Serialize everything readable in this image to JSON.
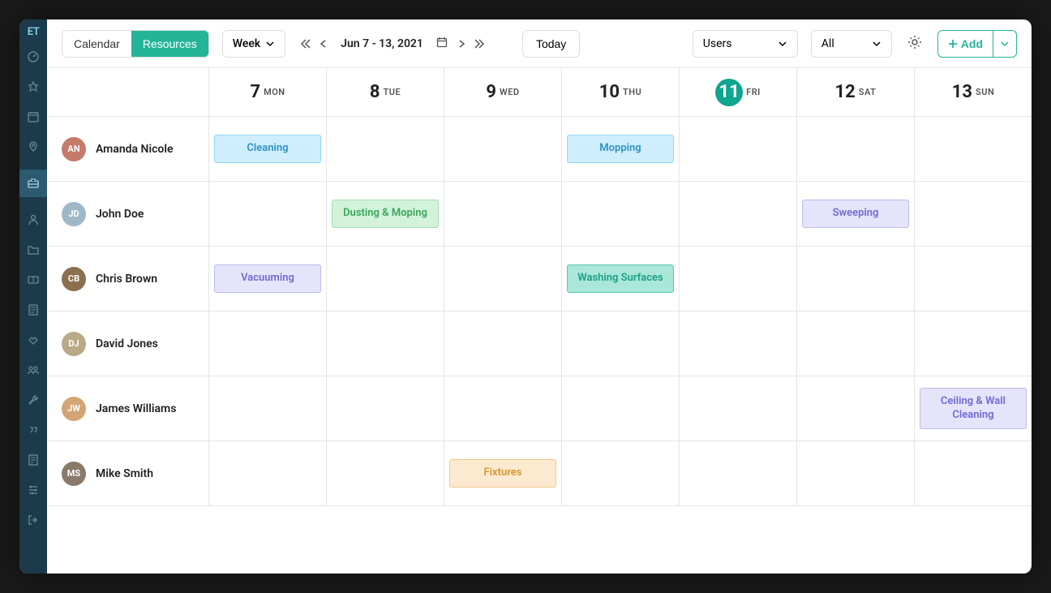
{
  "logo": "ET",
  "sidebar": {
    "icons": [
      "dashboard",
      "target",
      "calendar",
      "location",
      "briefcase",
      "person",
      "folder",
      "money",
      "document",
      "handshake",
      "team",
      "wrench",
      "quotes",
      "receipt",
      "sliders",
      "logout"
    ],
    "active_index": 4
  },
  "toolbar": {
    "tabs": [
      "Calendar",
      "Resources"
    ],
    "active_tab": 1,
    "view": "Week",
    "date_range": "Jun 7 - 13, 2021",
    "today": "Today",
    "filter1": "Users",
    "filter2": "All",
    "add": "Add"
  },
  "days": [
    {
      "num": "7",
      "name": "MON",
      "today": false
    },
    {
      "num": "8",
      "name": "TUE",
      "today": false
    },
    {
      "num": "9",
      "name": "WED",
      "today": false
    },
    {
      "num": "10",
      "name": "THU",
      "today": false
    },
    {
      "num": "11",
      "name": "FRI",
      "today": true
    },
    {
      "num": "12",
      "name": "SAT",
      "today": false
    },
    {
      "num": "13",
      "name": "SUN",
      "today": false
    }
  ],
  "resources": [
    {
      "name": "Amanda Nicole",
      "initials": "AN",
      "color": "#c47b6a"
    },
    {
      "name": "John Doe",
      "initials": "JD",
      "color": "#9fb8c8"
    },
    {
      "name": "Chris Brown",
      "initials": "CB",
      "color": "#8b6f4e"
    },
    {
      "name": "David Jones",
      "initials": "DJ",
      "color": "#b8a988"
    },
    {
      "name": "James Williams",
      "initials": "JW",
      "color": "#d4a574"
    },
    {
      "name": "Mike Smith",
      "initials": "MS",
      "color": "#8a7a6a"
    }
  ],
  "events": [
    {
      "resource": 0,
      "day": 0,
      "label": "Cleaning",
      "style": "blue"
    },
    {
      "resource": 0,
      "day": 3,
      "label": "Mopping",
      "style": "blue"
    },
    {
      "resource": 1,
      "day": 1,
      "label": "Dusting & Moping",
      "style": "green"
    },
    {
      "resource": 1,
      "day": 5,
      "label": "Sweeping",
      "style": "purple"
    },
    {
      "resource": 2,
      "day": 0,
      "label": "Vacuuming",
      "style": "purple"
    },
    {
      "resource": 2,
      "day": 3,
      "label": "Washing Surfaces",
      "style": "teal"
    },
    {
      "resource": 4,
      "day": 6,
      "label": "Ceiling & Wall Cleaning",
      "style": "purple"
    },
    {
      "resource": 5,
      "day": 2,
      "label": "Fixtures",
      "style": "orange"
    }
  ]
}
